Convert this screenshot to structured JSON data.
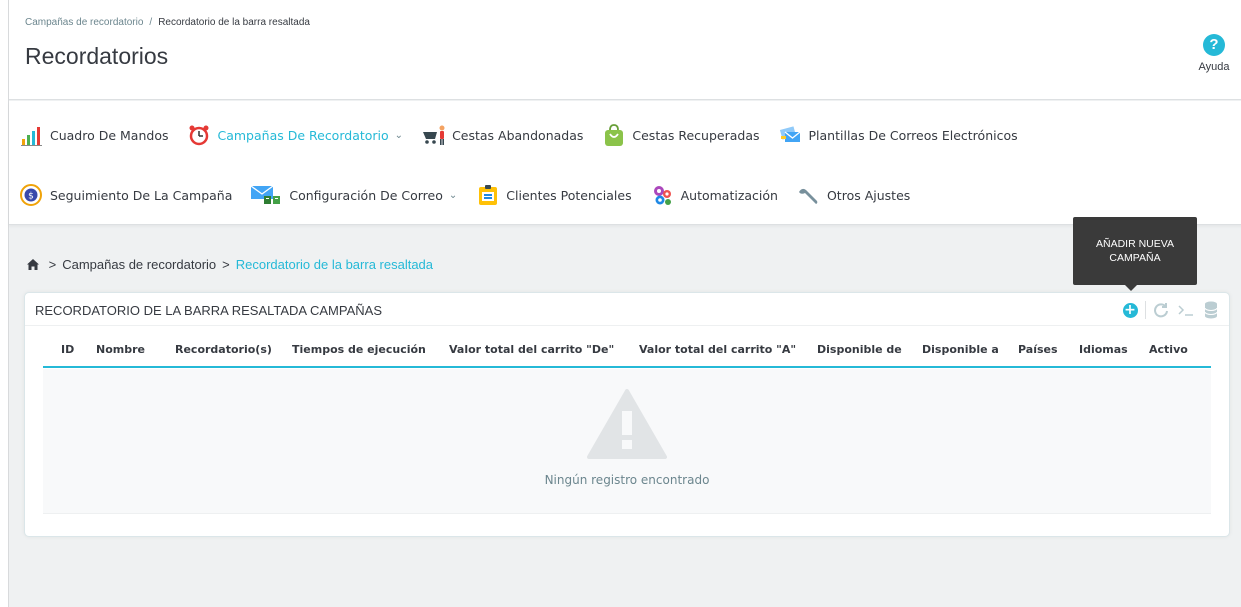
{
  "header": {
    "breadcrumb_parent": "Campañas de recordatorio",
    "breadcrumb_separator": "/",
    "breadcrumb_current": "Recordatorio de la barra resaltada",
    "title": "Recordatorios",
    "help_label": "Ayuda",
    "help_icon": "help-icon",
    "accent_color": "#25b9d7"
  },
  "menu": {
    "row1": [
      {
        "label": "Cuadro De Mandos",
        "icon": "bar-chart-icon",
        "active": false
      },
      {
        "label": "Campañas De Recordatorio",
        "icon": "alarm-clock-icon",
        "active": true,
        "dropdown": true
      },
      {
        "label": "Cestas Abandonadas",
        "icon": "shopping-cart-icon",
        "active": false
      },
      {
        "label": "Cestas Recuperadas",
        "icon": "shopping-bag-icon",
        "active": false
      },
      {
        "label": "Plantillas De Correos Electrónicos",
        "icon": "email-templates-icon",
        "active": false
      }
    ],
    "row2": [
      {
        "label": "Seguimiento De La Campaña",
        "icon": "tracking-icon",
        "active": false
      },
      {
        "label": "Configuración De Correo",
        "icon": "mail-config-icon",
        "active": false,
        "dropdown": true
      },
      {
        "label": "Clientes Potenciales",
        "icon": "leads-icon",
        "active": false
      },
      {
        "label": "Automatización",
        "icon": "gears-icon",
        "active": false
      },
      {
        "label": "Otros Ajustes",
        "icon": "wrench-icon",
        "active": false
      }
    ]
  },
  "breadcrumb": {
    "home_icon": "home-icon",
    "arrow": ">",
    "parent": "Campañas de recordatorio",
    "current": "Recordatorio de la barra resaltada"
  },
  "tooltip": {
    "line1": "AÑADIR NUEVA",
    "line2": "CAMPAÑA"
  },
  "panel": {
    "title": "RECORDATORIO DE LA BARRA RESALTADA CAMPAÑAS",
    "toolbar": [
      "add-icon",
      "refresh-icon",
      "terminal-icon",
      "database-icon"
    ],
    "columns": [
      "ID",
      "Nombre",
      "Recordatorio(s)",
      "Tiempos de ejecución",
      "Valor total del carrito \"De\"",
      "Valor total del carrito \"A\"",
      "Disponible de",
      "Disponible a",
      "Países",
      "Idiomas",
      "Activo"
    ],
    "empty_message": "Ningún registro encontrado"
  }
}
